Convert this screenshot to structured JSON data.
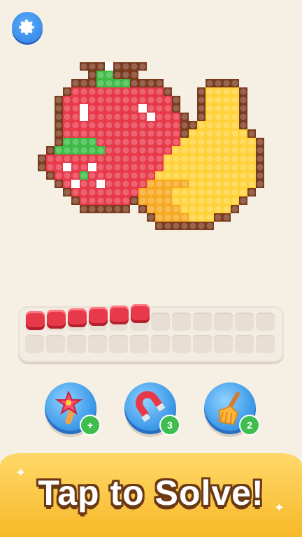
{
  "call_to_action": "Tap to Solve!",
  "tray": {
    "filled_count": 6,
    "slots_per_row": 12,
    "rows": 2,
    "tile_color": "#e7394a"
  },
  "boosters": [
    {
      "name": "magic-wand",
      "badge": "+"
    },
    {
      "name": "magnet",
      "badge": "3"
    },
    {
      "name": "broom",
      "badge": "2"
    }
  ],
  "colors": {
    "background": "#f6efe4",
    "outline": "#7a3a1e",
    "red": "#e7394a",
    "green": "#3dbb45",
    "yellow": "#ffd23a",
    "orange": "#f7a823",
    "white": "#ffffff"
  }
}
